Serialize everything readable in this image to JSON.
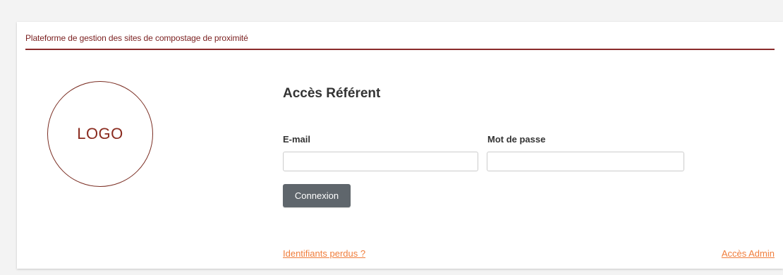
{
  "header": {
    "title": "Plateforme de gestion des sites de compostage de proximité"
  },
  "logo": {
    "text": "LOGO"
  },
  "login": {
    "title": "Accès Référent",
    "email_label": "E-mail",
    "email_value": "",
    "password_label": "Mot de passe",
    "password_value": "",
    "submit_label": "Connexion"
  },
  "links": {
    "lost_credentials": "Identifiants perdus ?",
    "admin_access": "Accès Admin"
  },
  "colors": {
    "brand": "#7a1f1f",
    "link": "#f07d3b",
    "button": "#5f666c"
  }
}
